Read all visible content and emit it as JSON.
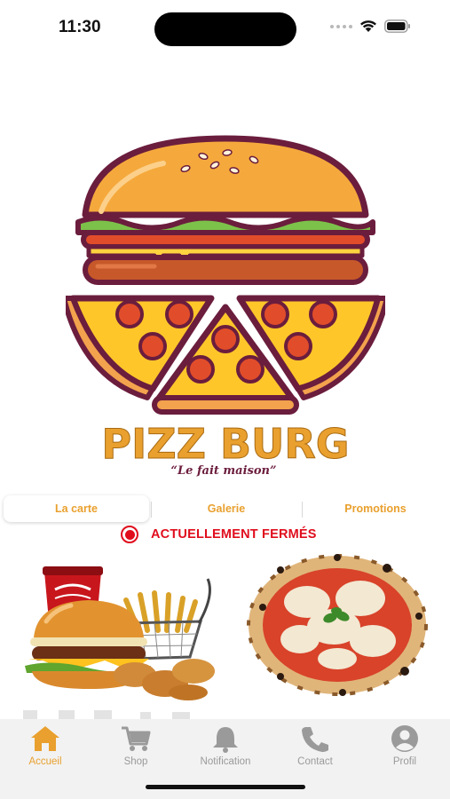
{
  "status_bar": {
    "time": "11:30"
  },
  "brand": {
    "name": "PIZZ BURG",
    "tagline": "“Le fait maison”",
    "colors": {
      "accent": "#e9a02e",
      "outline": "#6b1d3d",
      "pizza_red": "#e14d2a",
      "bun": "#f5a93c"
    }
  },
  "tabs": [
    {
      "label": "La carte",
      "active": true
    },
    {
      "label": "Galerie",
      "active": false
    },
    {
      "label": "Promotions",
      "active": false
    }
  ],
  "open_status": {
    "label": "ACTUELLEMENT FERMÉS",
    "color": "#e00d1d"
  },
  "products": [
    {
      "name": "burger-menu",
      "icon": "burger-fries-drink-image"
    },
    {
      "name": "pizza",
      "icon": "margherita-pizza-image"
    }
  ],
  "nav": {
    "items": [
      {
        "label": "Accueil",
        "icon": "home-icon",
        "active": true
      },
      {
        "label": "Shop",
        "icon": "cart-icon",
        "active": false
      },
      {
        "label": "Notification",
        "icon": "bell-icon",
        "active": false
      },
      {
        "label": "Contact",
        "icon": "phone-icon",
        "active": false
      },
      {
        "label": "Profil",
        "icon": "profile-icon",
        "active": false
      }
    ],
    "active_color": "#e9a02e",
    "inactive_color": "#9a9a9a"
  }
}
